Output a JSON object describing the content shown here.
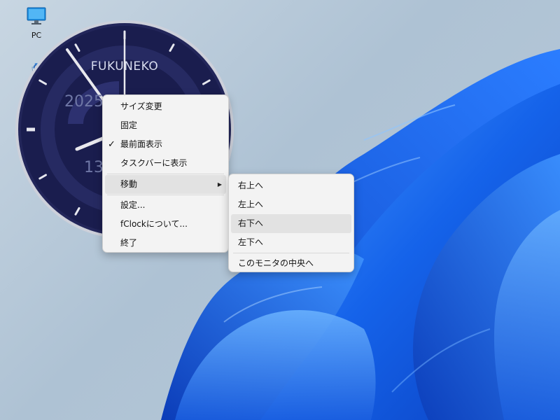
{
  "desktop": {
    "icons": [
      {
        "label": "PC",
        "icon": "monitor-icon"
      },
      {
        "label": "",
        "icon": "recycle-bin-icon"
      }
    ]
  },
  "clock": {
    "brand": "FUKUNEKO",
    "date_partial": "2025",
    "time_partial": "13",
    "colors": {
      "face": "#1a1d4e",
      "bezel": "#c9cbd4",
      "hands": "#e8e8ee"
    }
  },
  "context_menu": {
    "items": [
      {
        "label": "サイズ変更"
      },
      {
        "label": "固定"
      },
      {
        "label": "最前面表示",
        "checked": true
      },
      {
        "label": "タスクバーに表示"
      },
      {
        "label": "移動",
        "has_submenu": true
      },
      {
        "label": "設定..."
      },
      {
        "label": "fClockについて..."
      },
      {
        "label": "終了"
      }
    ],
    "check_glyph": "✓",
    "arrow_glyph": "▶"
  },
  "move_submenu": {
    "items": [
      {
        "label": "右上へ"
      },
      {
        "label": "左上へ"
      },
      {
        "label": "右下へ",
        "highlighted": true
      },
      {
        "label": "左下へ"
      },
      {
        "label": "このモニタの中央へ"
      }
    ]
  },
  "colors": {
    "wallpaper_bg": "#b9cad9",
    "bloom_blue": "#1f6ff0",
    "menu_bg": "#f3f3f3",
    "highlight": "#e2e2e2"
  }
}
